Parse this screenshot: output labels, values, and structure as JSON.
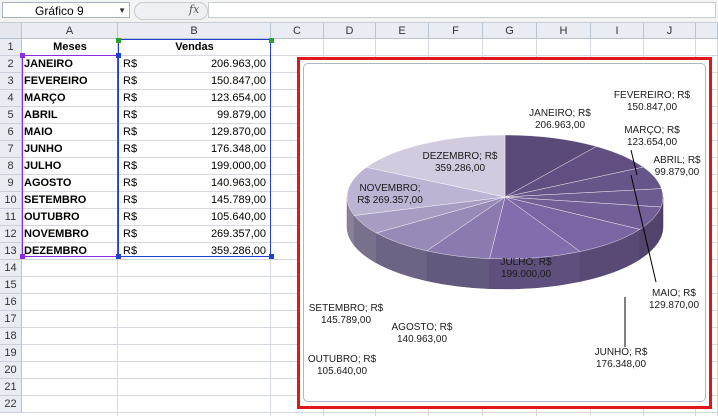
{
  "formula_bar": {
    "name_box": "Gráfico 9",
    "fx": "fx",
    "formula": ""
  },
  "columns": [
    "A",
    "B",
    "C",
    "D",
    "E",
    "F",
    "G",
    "H",
    "I",
    "J"
  ],
  "rows": [
    "1",
    "2",
    "3",
    "4",
    "5",
    "6",
    "7",
    "8",
    "9",
    "10",
    "11",
    "12",
    "13",
    "14",
    "15",
    "16",
    "17",
    "18",
    "19",
    "20",
    "21",
    "22"
  ],
  "table": {
    "header_mes": "Meses",
    "header_vendas": "Vendas",
    "currency": "R$",
    "rows": [
      {
        "mes": "JANEIRO",
        "valor": "206.963,00"
      },
      {
        "mes": "FEVEREIRO",
        "valor": "150.847,00"
      },
      {
        "mes": "MARÇO",
        "valor": "123.654,00"
      },
      {
        "mes": "ABRIL",
        "valor": "99.879,00"
      },
      {
        "mes": "MAIO",
        "valor": "129.870,00"
      },
      {
        "mes": "JUNHO",
        "valor": "176.348,00"
      },
      {
        "mes": "JULHO",
        "valor": "199.000,00"
      },
      {
        "mes": "AGOSTO",
        "valor": "140.963,00"
      },
      {
        "mes": "SETEMBRO",
        "valor": "145.789,00"
      },
      {
        "mes": "OUTUBRO",
        "valor": "105.640,00"
      },
      {
        "mes": "NOVEMBRO",
        "valor": "269.357,00"
      },
      {
        "mes": "DEZEMBRO",
        "valor": "359.286,00"
      }
    ]
  },
  "chart_data": {
    "type": "pie",
    "categories": [
      "JANEIRO",
      "FEVEREIRO",
      "MARÇO",
      "ABRIL",
      "MAIO",
      "JUNHO",
      "JULHO",
      "AGOSTO",
      "SETEMBRO",
      "OUTUBRO",
      "NOVEMBRO",
      "DEZEMBRO"
    ],
    "values": [
      206963,
      150847,
      123654,
      99879,
      129870,
      176348,
      199000,
      140963,
      145789,
      105640,
      269357,
      359286
    ],
    "data_labels": [
      "JANEIRO; R$ 206.963,00",
      "FEVEREIRO; R$ 150.847,00",
      "MARÇO; R$ 123.654,00",
      "ABRIL; R$ 99.879,00",
      "MAIO; R$ 129.870,00",
      "JUNHO; R$ 176.348,00",
      "JULHO; R$ 199.000,00",
      "AGOSTO; R$ 140.963,00",
      "SETEMBRO; R$ 145.789,00",
      "OUTUBRO; R$ 105.640,00",
      "NOVEMBRO; R$ 269.357,00",
      "DEZEMBRO; R$ 359.286,00"
    ],
    "style": "3d-pie",
    "colors": [
      "#5a4a78",
      "#604f80",
      "#665588",
      "#6c5b90",
      "#735f98",
      "#7a66a2",
      "#826ead",
      "#8a7aaf",
      "#978ab7",
      "#a89cc3",
      "#bdb3d3",
      "#d2cbe0"
    ],
    "label_lines": [
      "label_a",
      "label_b"
    ]
  },
  "accents": {
    "selection_border": "#e0161c",
    "range_b": "#1f3fd0",
    "range_a": "#8a2be2"
  }
}
